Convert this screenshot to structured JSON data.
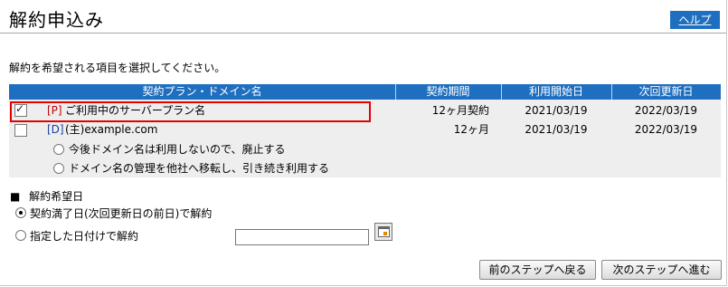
{
  "page": {
    "title": "解約申込み",
    "help_label": "ヘルプ",
    "instruction": "解約を希望される項目を選択してください。"
  },
  "table": {
    "headers": [
      "契約プラン・ドメイン名",
      "契約期間",
      "利用開始日",
      "次回更新日"
    ],
    "rows": [
      {
        "checked": true,
        "tag": "[P]",
        "name": "ご利用中のサーバープラン名",
        "period": "12ヶ月契約",
        "start": "2021/03/19",
        "renewal": "2022/03/19"
      },
      {
        "checked": false,
        "tag": "[D]",
        "name": "(主)example.com",
        "period": "12ヶ月",
        "start": "2021/03/19",
        "renewal": "2022/03/19"
      }
    ],
    "domain_options": [
      {
        "label": "今後ドメイン名は利用しないので、廃止する",
        "selected": false
      },
      {
        "label": "ドメイン名の管理を他社へ移転し、引き続き利用する",
        "selected": false
      }
    ]
  },
  "date_section": {
    "heading_marker": "■",
    "heading": "解約希望日",
    "options": [
      {
        "label": "契約満了日(次回更新日の前日)で解約",
        "selected": true
      },
      {
        "label": "指定した日付けで解約",
        "selected": false
      }
    ],
    "date_value": ""
  },
  "footer": {
    "back_label": "前のステップへ戻る",
    "next_label": "次のステップへ進む"
  },
  "colors": {
    "header_blue": "#1f6fc0",
    "highlight_red": "#e60000",
    "tag_red": "#c00000",
    "tag_blue": "#1a3fa0",
    "table_bg": "#eeeeee"
  }
}
